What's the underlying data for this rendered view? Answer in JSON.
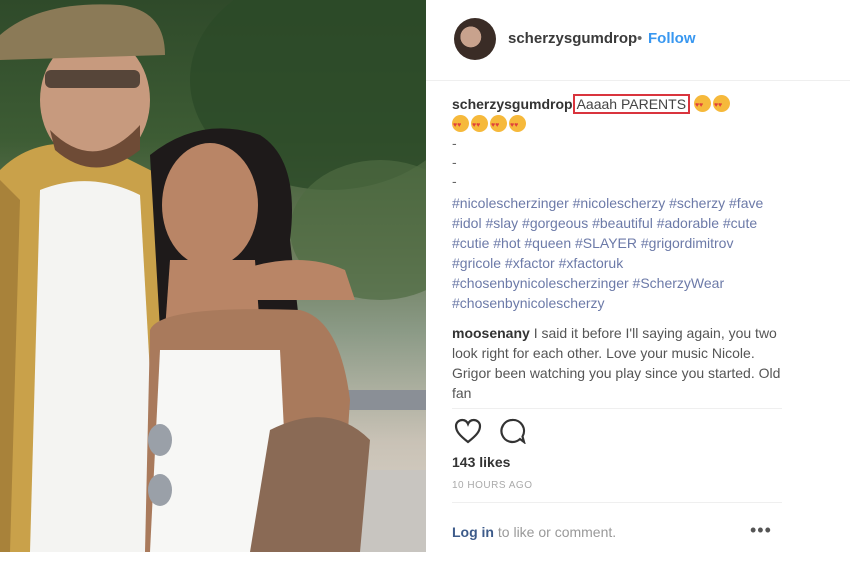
{
  "post": {
    "username": "scherzysgumdrop",
    "separator": "•",
    "follow_label": "Follow",
    "caption": {
      "username": "scherzysgumdrop",
      "highlighted_text": "Aaaah PARENTS",
      "dashes": [
        "-",
        "-",
        "-"
      ],
      "hashtags": "#nicolescherzinger #nicolescherzy #scherzy #fave #idol #slay #gorgeous #beautiful #adorable #cute #cutie #hot #queen #SLAYER #grigordimitrov #gricole #xfactor #xfactoruk #chosenbynicolescherzinger #ScherzyWear #chosenbynicolescherzy"
    },
    "comment": {
      "username": "moosenany",
      "text": "I said it before I'll saying again, you two look right for each other. Love your music Nicole. Grigor been watching you play since you started. Old fan"
    },
    "likes": "143 likes",
    "time": "10 HOURS AGO",
    "login_link": "Log in",
    "login_rest": " to like or comment.",
    "more_label": "•••"
  },
  "icons": [
    "heart-icon",
    "comment-icon",
    "more-icon"
  ],
  "colors": {
    "follow": "#3897f0",
    "highlight_box": "#d9343d",
    "hashtag": "#6c7aa8"
  }
}
